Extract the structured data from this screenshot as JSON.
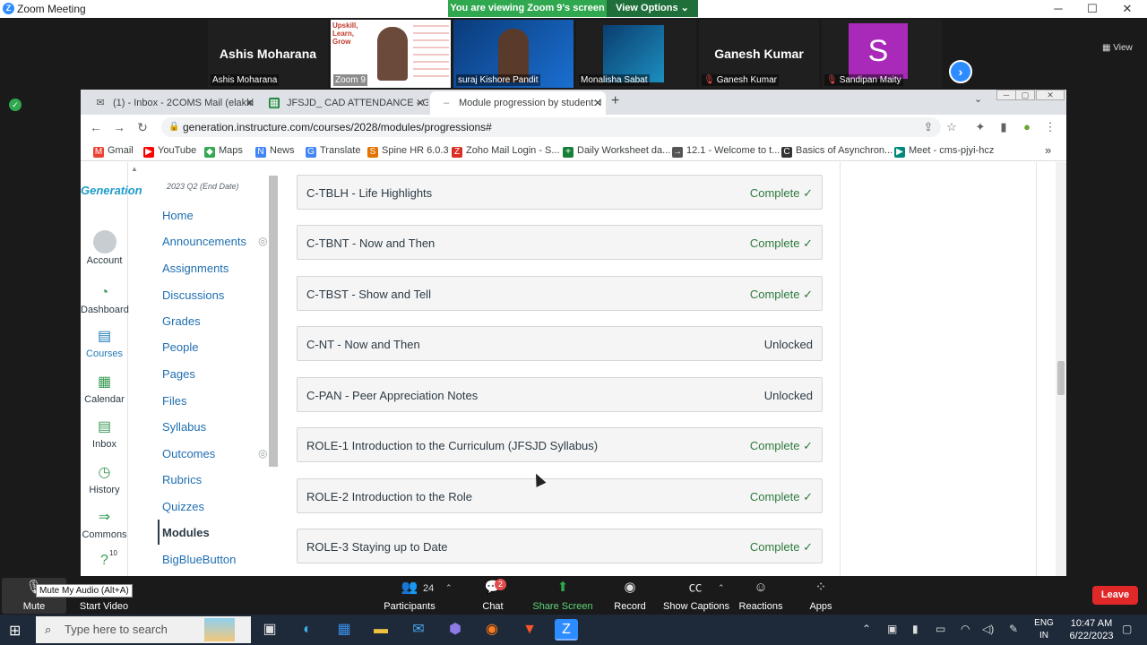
{
  "zoom": {
    "window_title": "Zoom Meeting",
    "logo_letter": "Z",
    "banner_message": "You are viewing Zoom 9's screen",
    "view_options_label": "View Options",
    "view_label": "View",
    "window_controls": {
      "minimize": "─",
      "maximize": "☐",
      "close": "✕"
    }
  },
  "gallery": {
    "participants": [
      {
        "big_name": "Ashis Moharana",
        "label": "Ashis Moharana",
        "muted": false
      },
      {
        "big_name": "",
        "label": "Zoom 9",
        "muted": false
      },
      {
        "big_name": "",
        "label": "suraj Kishore Pandit",
        "muted": false
      },
      {
        "big_name": "",
        "label": "Monalisha Sabat",
        "muted": false
      },
      {
        "big_name": "Ganesh Kumar",
        "label": "Ganesh Kumar",
        "muted": true
      },
      {
        "big_name": "S",
        "label": "Sandipan Maity",
        "muted": true
      }
    ],
    "zoom9_overlay": [
      "Upskill,",
      "Learn,",
      "Grow"
    ],
    "next_arrow": "›"
  },
  "chrome": {
    "tabs": [
      {
        "label": "(1) - Inbox - 2COMS Mail (elakki",
        "icon": "✉",
        "active": false
      },
      {
        "label": "JFSJD_ CAD ATTENDANCE - Goo",
        "icon": "▦",
        "active": false
      },
      {
        "label": "Module progression by student: I",
        "icon": "–",
        "active": true
      }
    ],
    "tab_close": "✕",
    "new_tab": "+",
    "window_controls": {
      "min": "─",
      "max": "▢",
      "close": "✕"
    },
    "url": "generation.instructure.com/courses/2028/modules/progressions#",
    "lock_icon": "🔒",
    "bookmarks": [
      {
        "label": "Gmail",
        "icon": "M",
        "color": "#ea4335"
      },
      {
        "label": "YouTube",
        "icon": "▶",
        "color": "#ff0000"
      },
      {
        "label": "Maps",
        "icon": "◆",
        "color": "#34a853"
      },
      {
        "label": "News",
        "icon": "N",
        "color": "#4285f4"
      },
      {
        "label": "Translate",
        "icon": "G",
        "color": "#4285f4"
      },
      {
        "label": "Spine HR 6.0.3",
        "icon": "S",
        "color": "#e37400"
      },
      {
        "label": "Zoho Mail Login - S...",
        "icon": "Z",
        "color": "#d93025"
      },
      {
        "label": "Daily Worksheet da...",
        "icon": "+",
        "color": "#188038"
      },
      {
        "label": "12.1 - Welcome to t...",
        "icon": "→",
        "color": "#555555"
      },
      {
        "label": "Basics of Asynchron...",
        "icon": "C",
        "color": "#333333"
      },
      {
        "label": "Meet - cms-pjyi-hcz",
        "icon": "▶",
        "color": "#00897b"
      }
    ],
    "bookmarks_more": "»"
  },
  "canvas": {
    "logo_text": "Generation",
    "global_nav": [
      {
        "label": "Account",
        "icon": "account"
      },
      {
        "label": "Dashboard",
        "icon": "◔"
      },
      {
        "label": "Courses",
        "icon": "▤"
      },
      {
        "label": "Calendar",
        "icon": "▦"
      },
      {
        "label": "Inbox",
        "icon": "▤"
      },
      {
        "label": "History",
        "icon": "◷"
      },
      {
        "label": "Commons",
        "icon": "⇒"
      },
      {
        "label": "Help",
        "icon": "?"
      }
    ],
    "help_badge": "10",
    "term": "2023 Q2 (End Date)",
    "course_nav": [
      {
        "label": "Home",
        "hidden": false
      },
      {
        "label": "Announcements",
        "hidden": true
      },
      {
        "label": "Assignments",
        "hidden": false
      },
      {
        "label": "Discussions",
        "hidden": false
      },
      {
        "label": "Grades",
        "hidden": false
      },
      {
        "label": "People",
        "hidden": false
      },
      {
        "label": "Pages",
        "hidden": false
      },
      {
        "label": "Files",
        "hidden": false
      },
      {
        "label": "Syllabus",
        "hidden": false
      },
      {
        "label": "Outcomes",
        "hidden": true
      },
      {
        "label": "Rubrics",
        "hidden": false
      },
      {
        "label": "Quizzes",
        "hidden": false
      },
      {
        "label": "Modules",
        "hidden": false
      },
      {
        "label": "BigBlueButton",
        "hidden": false
      }
    ],
    "active_course_nav": "Modules",
    "modules": [
      {
        "name": "C-TBLH - Life Highlights",
        "status": "Complete ✓",
        "done": true
      },
      {
        "name": "C-TBNT - Now and Then",
        "status": "Complete ✓",
        "done": true
      },
      {
        "name": "C-TBST - Show and Tell",
        "status": "Complete ✓",
        "done": true
      },
      {
        "name": "C-NT - Now and Then",
        "status": "Unlocked",
        "done": false
      },
      {
        "name": "C-PAN - Peer Appreciation Notes",
        "status": "Unlocked",
        "done": false
      },
      {
        "name": "ROLE-1 Introduction to the Curriculum (JFSJD Syllabus)",
        "status": "Complete ✓",
        "done": true
      },
      {
        "name": "ROLE-2 Introduction to the Role",
        "status": "Complete ✓",
        "done": true
      },
      {
        "name": "ROLE-3 Staying up to Date",
        "status": "Complete ✓",
        "done": true
      }
    ]
  },
  "toolbar": {
    "mute": "Mute",
    "mute_tooltip": "Mute My Audio (Alt+A)",
    "start_video": "Start Video",
    "participants": "Participants",
    "participants_count": "24",
    "chat": "Chat",
    "chat_badge": "2",
    "share_screen": "Share Screen",
    "record": "Record",
    "show_captions": "Show Captions",
    "reactions": "Reactions",
    "apps": "Apps",
    "leave": "Leave"
  },
  "taskbar": {
    "search_placeholder": "Type here to search",
    "lang_line1": "ENG",
    "lang_line2": "IN",
    "time": "10:47 AM",
    "date": "6/22/2023"
  }
}
